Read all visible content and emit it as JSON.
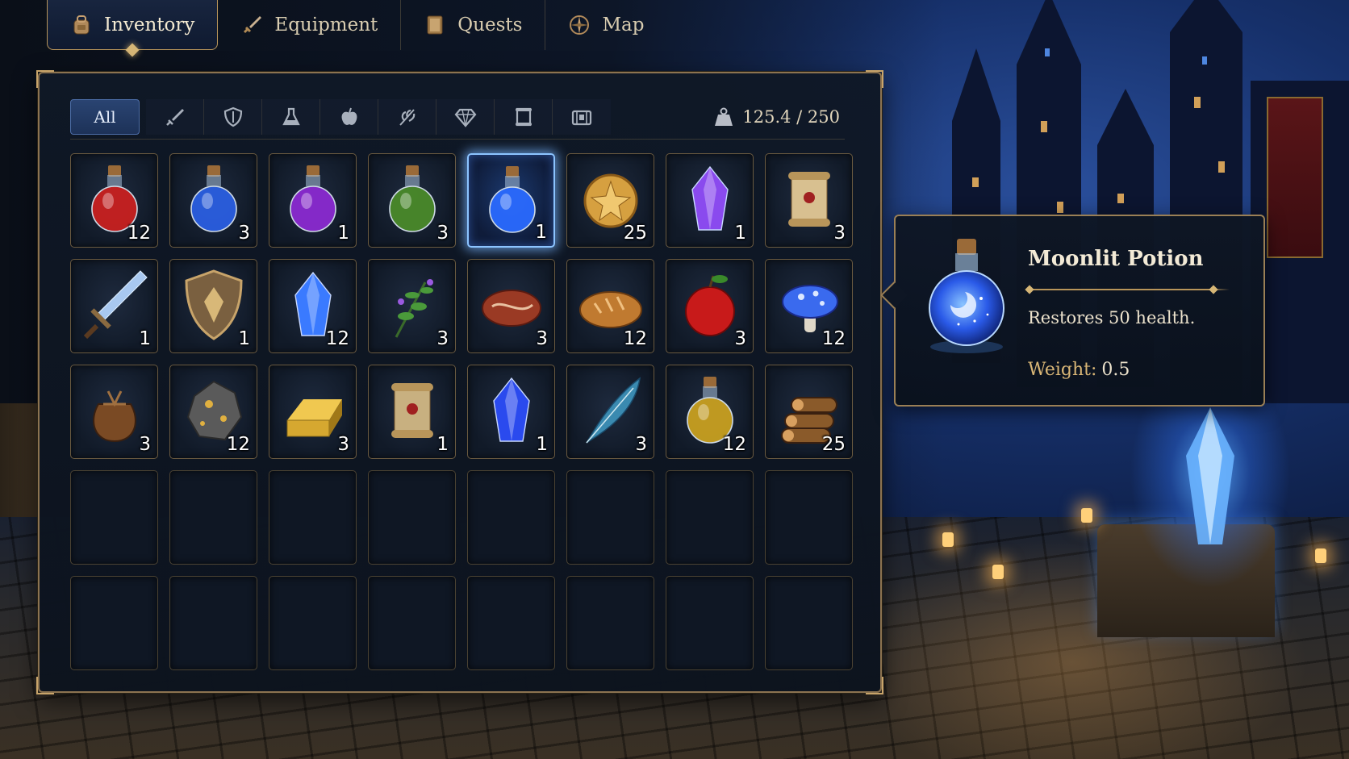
{
  "tabs": [
    {
      "label": "Inventory",
      "icon": "backpack-icon",
      "active": true
    },
    {
      "label": "Equipment",
      "icon": "sword-icon",
      "active": false
    },
    {
      "label": "Quests",
      "icon": "book-icon",
      "active": false
    },
    {
      "label": "Map",
      "icon": "compass-icon",
      "active": false
    }
  ],
  "filters": {
    "all_label": "All",
    "icons": [
      "sword-icon",
      "shield-icon",
      "flask-icon",
      "apple-icon",
      "leaf-icon",
      "gem-icon",
      "scroll-icon",
      "chest-icon"
    ]
  },
  "weight": {
    "text": "125.4 / 250",
    "icon": "weight-icon"
  },
  "items": [
    {
      "name": "red-potion",
      "qty": "12",
      "color": "#c82020"
    },
    {
      "name": "blue-potion",
      "qty": "3",
      "color": "#2a5ee0"
    },
    {
      "name": "purple-potion",
      "qty": "1",
      "color": "#8a2ad0"
    },
    {
      "name": "green-potion",
      "qty": "3",
      "color": "#4a8a2a"
    },
    {
      "name": "moonlit-potion",
      "qty": "1",
      "color": "#2a6aff"
    },
    {
      "name": "gold-coin",
      "qty": "25",
      "color": "#d6a040"
    },
    {
      "name": "amethyst-crystal",
      "qty": "1",
      "color": "#8a4aee"
    },
    {
      "name": "parchment-scroll",
      "qty": "3",
      "color": "#d8c090"
    },
    {
      "name": "steel-sword",
      "qty": "1",
      "color": "#a8c8f0"
    },
    {
      "name": "eagle-shield",
      "qty": "1",
      "color": "#7a6040"
    },
    {
      "name": "blue-crystal",
      "qty": "12",
      "color": "#3a7aff"
    },
    {
      "name": "herb-sprig",
      "qty": "3",
      "color": "#4a9a3a"
    },
    {
      "name": "steak",
      "qty": "3",
      "color": "#9a3a24"
    },
    {
      "name": "bread-loaf",
      "qty": "12",
      "color": "#c07a30"
    },
    {
      "name": "red-apple",
      "qty": "3",
      "color": "#c81a1a"
    },
    {
      "name": "blue-mushroom",
      "qty": "12",
      "color": "#3a6aee"
    },
    {
      "name": "leather-pouch",
      "qty": "3",
      "color": "#7a4a24"
    },
    {
      "name": "iron-ore",
      "qty": "12",
      "color": "#5a5a5a"
    },
    {
      "name": "gold-bar",
      "qty": "3",
      "color": "#d6a830"
    },
    {
      "name": "rolled-scroll",
      "qty": "1",
      "color": "#c8b080"
    },
    {
      "name": "sapphire-gem",
      "qty": "1",
      "color": "#2a4aee"
    },
    {
      "name": "blue-feather",
      "qty": "3",
      "color": "#3a8ab0"
    },
    {
      "name": "oil-flask",
      "qty": "12",
      "color": "#c8a020"
    },
    {
      "name": "wood-logs",
      "qty": "25",
      "color": "#8a5a2a"
    }
  ],
  "empty_slots": 16,
  "selected_index": 4,
  "tooltip": {
    "name": "Moonlit Potion",
    "description": "Restores 50 health.",
    "weight_label": "Weight:",
    "weight_value": "0.5"
  },
  "colors": {
    "accent_gold": "#b8955a",
    "selected_glow": "#8cc4ff",
    "panel_bg": "#0f1826"
  }
}
